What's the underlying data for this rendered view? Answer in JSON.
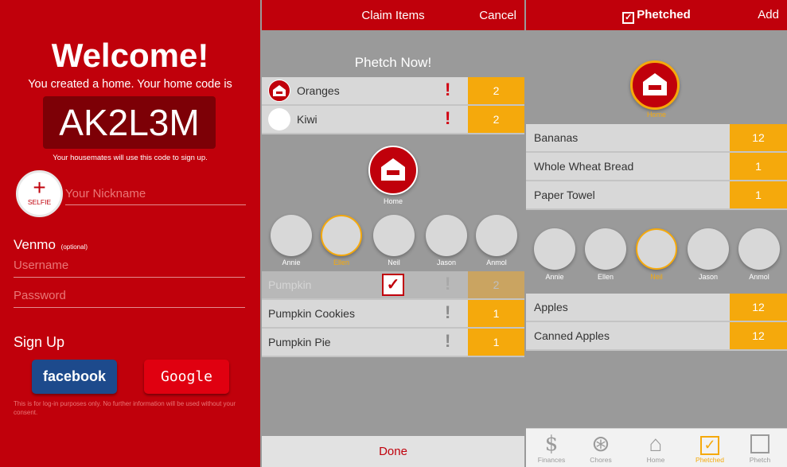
{
  "panel1": {
    "welcome": "Welcome!",
    "created": "You created a home. Your home code is",
    "home_code": "AK2L3M",
    "code_note": "Your housemates will use this code to sign up.",
    "selfie_plus": "+",
    "selfie_label": "SELFIE",
    "nickname_placeholder": "Your Nickname",
    "venmo_label": "Venmo",
    "venmo_optional": "(optional)",
    "username_placeholder": "Username",
    "password_placeholder": "Password",
    "signup_label": "Sign Up",
    "facebook_label": "facebook",
    "google_label": "Google",
    "disclaimer": "This is for log-in purposes only. No further information will be used without your consent."
  },
  "panel2": {
    "title": "Claim Items",
    "cancel": "Cancel",
    "phetch_now": "Phetch Now!",
    "urgent_items": [
      {
        "name": "Oranges",
        "qty": "2",
        "mark": "!"
      },
      {
        "name": "Kiwi",
        "qty": "2",
        "mark": "!"
      }
    ],
    "home_label": "Home",
    "people": [
      "Annie",
      "Ellen",
      "Neil",
      "Jason",
      "Anmol"
    ],
    "selected_person": "Ellen",
    "items": [
      {
        "name": "Pumpkin",
        "qty": "2",
        "mark": "!",
        "checked": true
      },
      {
        "name": "Pumpkin Cookies",
        "qty": "1",
        "mark": "!"
      },
      {
        "name": "Pumpkin Pie",
        "qty": "1",
        "mark": "!"
      }
    ],
    "check_mark": "✓",
    "done": "Done"
  },
  "panel3": {
    "title": "Phetched",
    "title_check": "✓",
    "add": "Add",
    "home_label": "Home",
    "home_items": [
      {
        "name": "Bananas",
        "qty": "12"
      },
      {
        "name": "Whole Wheat Bread",
        "qty": "1"
      },
      {
        "name": "Paper Towel",
        "qty": "1"
      }
    ],
    "people": [
      "Annie",
      "Ellen",
      "Neil",
      "Jason",
      "Anmol"
    ],
    "selected_person": "Neil",
    "person_items": [
      {
        "name": "Apples",
        "qty": "12"
      },
      {
        "name": "Canned Apples",
        "qty": "12"
      }
    ],
    "tabs": [
      {
        "label": "Finances",
        "icon": "dollar-icon",
        "glyph": "$"
      },
      {
        "label": "Chores",
        "icon": "wheel-icon",
        "glyph": "⊛"
      },
      {
        "label": "Home",
        "icon": "house-icon",
        "glyph": "⌂"
      },
      {
        "label": "Phetched",
        "icon": "checkbox-icon",
        "glyph": "✓"
      },
      {
        "label": "Phetch",
        "icon": "empty-box-icon",
        "glyph": ""
      }
    ],
    "active_tab": "Phetched"
  },
  "colors": {
    "brand_red": "#c0000b",
    "dark_red": "#7d0006",
    "accent_orange": "#f5a90c",
    "facebook_blue": "#1d4a8c",
    "google_red": "#e00010",
    "background_grey": "#9a9a9a",
    "row_grey": "#d8d8d8"
  }
}
